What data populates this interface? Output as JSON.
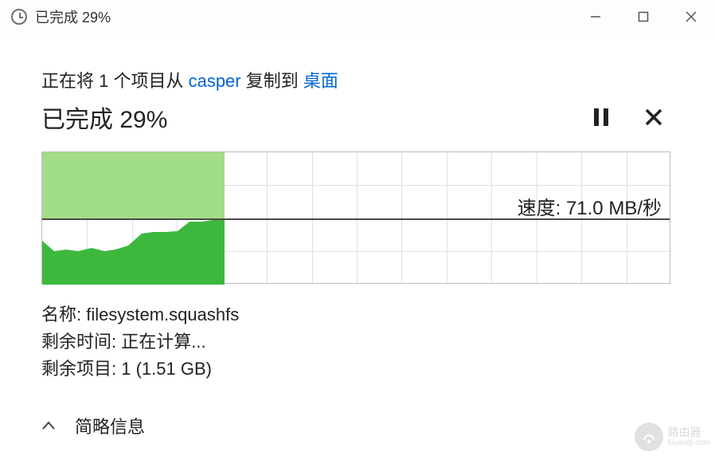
{
  "titlebar": {
    "title": "已完成 29%"
  },
  "description": {
    "prefix": "正在将 1 个项目从 ",
    "source": "casper",
    "middle": " 复制到 ",
    "destination": "桌面"
  },
  "progress": {
    "text": "已完成 29%"
  },
  "speed": {
    "label": "速度: 71.0 MB/秒"
  },
  "details": {
    "name_label": "名称: ",
    "name_value": "filesystem.squashfs",
    "time_label": "剩余时间: ",
    "time_value": "正在计算...",
    "items_label": "剩余项目: ",
    "items_value": "1 (1.51 GB)"
  },
  "footer": {
    "toggle": "简略信息"
  },
  "watermark": {
    "brand": "路由器",
    "site": "luyouqi.com"
  },
  "chart_data": {
    "type": "area",
    "title": "传输速度",
    "xlabel": "",
    "ylabel": "MB/秒",
    "ylim": [
      0,
      150
    ],
    "current_speed": 71.0,
    "progress_fraction": 0.29,
    "x": [
      0,
      0.02,
      0.04,
      0.06,
      0.08,
      0.1,
      0.12,
      0.14,
      0.16,
      0.18,
      0.2,
      0.22,
      0.24,
      0.26,
      0.28,
      0.29
    ],
    "values": [
      50,
      38,
      40,
      38,
      42,
      38,
      40,
      44,
      58,
      60,
      60,
      62,
      72,
      72,
      74,
      74
    ]
  }
}
